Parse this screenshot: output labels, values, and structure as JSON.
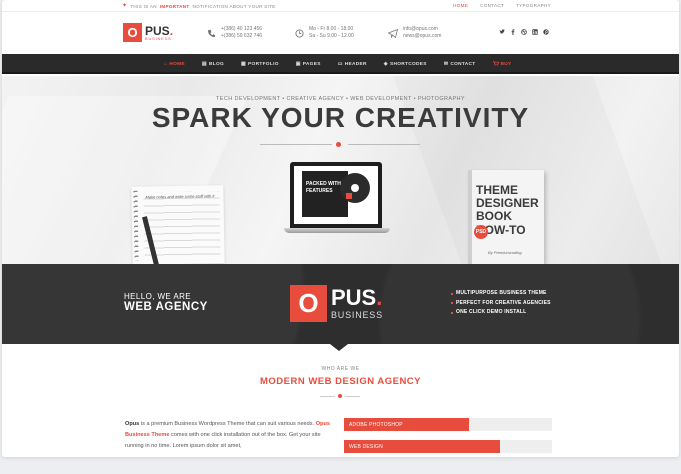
{
  "topbar": {
    "notice_pre": "THIS IS AN",
    "notice_bold": "IMPORTANT",
    "notice_post": "NOTIFICATION ABOUT YOUR SITE",
    "links": [
      "HOME",
      "CONTACT",
      "TYPOGRAPHY"
    ]
  },
  "header": {
    "logo_letter": "O",
    "logo_name": "PUS",
    "logo_dot": ".",
    "logo_sub": "BUSINESS",
    "phone_1": "+(386) 40 123 456",
    "phone_2": "+(386) 59 632 746",
    "hours_1": "Mo - Fr 8.00 - 18.00",
    "hours_2": "Sa - Su 9.00 - 12.00",
    "email_1": "info@opus.com",
    "email_2": "news@opus.com",
    "social_icons": [
      "twitter-icon",
      "facebook-icon",
      "dribbble-icon",
      "linkedin-icon",
      "pinterest-icon"
    ]
  },
  "nav": {
    "items": [
      {
        "label": "HOME",
        "icon": "home-icon",
        "glyph": "⌂"
      },
      {
        "label": "BLOG",
        "icon": "blog-icon",
        "glyph": "▤"
      },
      {
        "label": "PORTFOLIO",
        "icon": "portfolio-icon",
        "glyph": "▦"
      },
      {
        "label": "PAGES",
        "icon": "pages-icon",
        "glyph": "▣"
      },
      {
        "label": "HEADER",
        "icon": "header-icon",
        "glyph": "▭"
      },
      {
        "label": "SHORTCODES",
        "icon": "shortcodes-icon",
        "glyph": "◈"
      },
      {
        "label": "CONTACT",
        "icon": "contact-icon",
        "glyph": "✉"
      },
      {
        "label": "BUY",
        "icon": "cart-icon",
        "glyph": "🛒"
      }
    ]
  },
  "hero": {
    "tagline": "TECH DEVELOPMENT • CREATIVE AGENCY • WEB DEVELOPMENT • PHOTOGRAPHY",
    "headline": "SPARK YOUR CREATIVITY",
    "notepad_text": "Make notes and write some stuff with it",
    "dvd_text": "PACKED WITH FEATURES",
    "book_title": "THEME DESIGNER BOOK HOW-TO",
    "book_badge": "PSD",
    "book_author": "By Premiumcoding"
  },
  "band": {
    "hello": "HELLO, WE ARE",
    "agency": "WEB AGENCY",
    "logo_letter": "O",
    "logo_name": "PUS",
    "logo_dot": ".",
    "logo_sub": "BUSINESS",
    "features": [
      "MULTIPURPOSE BUSINESS THEME",
      "PERFECT FOR CREATIVE AGENCIES",
      "ONE CLICK DEMO INSTALL"
    ]
  },
  "section": {
    "eyebrow": "WHO ARE WE",
    "title": "MODERN WEB DESIGN AGENCY",
    "about_brand": "Opus",
    "about_part1": " is a premium Business Wordpress Theme that can suit various needs. ",
    "about_link": "Opus Business Theme",
    "about_part2": " comes with one click installation out of the box. Get your site running in no time. Lorem ipsum dolor sit amet,"
  },
  "skills": [
    {
      "label": "ADOBE PHOTOSHOP",
      "percent": 60
    },
    {
      "label": "WEB DESIGN",
      "percent": 75
    }
  ],
  "colors": {
    "accent": "#e74c3c",
    "dark": "#2e2e2e",
    "nav": "#2a2a2a"
  }
}
